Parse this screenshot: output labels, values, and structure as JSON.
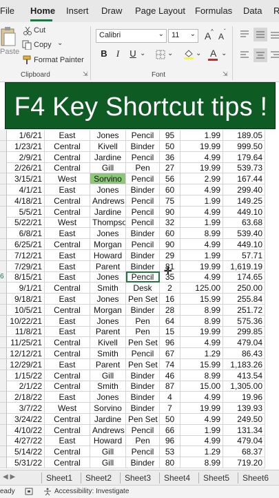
{
  "ribbon": {
    "tabs": [
      "File",
      "Home",
      "Insert",
      "Draw",
      "Page Layout",
      "Formulas",
      "Data",
      "R"
    ],
    "active_tab": "Home",
    "clipboard": {
      "paste": "Paste",
      "cut": "Cut",
      "copy": "Copy",
      "format_painter": "Format Painter",
      "label": "Clipboard"
    },
    "font": {
      "name": "Calibri",
      "size": "11",
      "grow": "A",
      "shrink": "A",
      "bold": "B",
      "italic": "I",
      "underline": "U",
      "color_letter": "A",
      "label": "Font"
    },
    "colors": {
      "fill": "#ffff00",
      "font": "#e02020",
      "accent": "#217346"
    }
  },
  "banner": {
    "text": "F4 Key Shortcut tips !",
    "background": "#0f5b24"
  },
  "rows": [
    [
      "1/6/21",
      "East",
      "Jones",
      "Pencil",
      "95",
      "1.99",
      "189.05"
    ],
    [
      "1/23/21",
      "Central",
      "Kivell",
      "Binder",
      "50",
      "19.99",
      "999.50"
    ],
    [
      "2/9/21",
      "Central",
      "Jardine",
      "Pencil",
      "36",
      "4.99",
      "179.64"
    ],
    [
      "2/26/21",
      "Central",
      "Gill",
      "Pen",
      "27",
      "19.99",
      "539.73"
    ],
    [
      "3/15/21",
      "West",
      "Sorvino",
      "Pencil",
      "56",
      "2.99",
      "167.44"
    ],
    [
      "4/1/21",
      "East",
      "Jones",
      "Binder",
      "60",
      "4.99",
      "299.40"
    ],
    [
      "4/18/21",
      "Central",
      "Andrews",
      "Pencil",
      "75",
      "1.99",
      "149.25"
    ],
    [
      "5/5/21",
      "Central",
      "Jardine",
      "Pencil",
      "90",
      "4.99",
      "449.10"
    ],
    [
      "5/22/21",
      "West",
      "Thompson",
      "Pencil",
      "32",
      "1.99",
      "63.68"
    ],
    [
      "6/8/21",
      "East",
      "Jones",
      "Binder",
      "60",
      "8.99",
      "539.40"
    ],
    [
      "6/25/21",
      "Central",
      "Morgan",
      "Pencil",
      "90",
      "4.99",
      "449.10"
    ],
    [
      "7/12/21",
      "East",
      "Howard",
      "Binder",
      "29",
      "1.99",
      "57.71"
    ],
    [
      "7/29/21",
      "East",
      "Parent",
      "Binder",
      "81",
      "19.99",
      "1,619.19"
    ],
    [
      "8/15/21",
      "East",
      "Jones",
      "Pencil",
      "35",
      "4.99",
      "174.65"
    ],
    [
      "9/1/21",
      "Central",
      "Smith",
      "Desk",
      "2",
      "125.00",
      "250.00"
    ],
    [
      "9/18/21",
      "East",
      "Jones",
      "Pen Set",
      "16",
      "15.99",
      "255.84"
    ],
    [
      "10/5/21",
      "Central",
      "Morgan",
      "Binder",
      "28",
      "8.99",
      "251.72"
    ],
    [
      "10/22/21",
      "East",
      "Jones",
      "Pen",
      "64",
      "8.99",
      "575.36"
    ],
    [
      "11/8/21",
      "East",
      "Parent",
      "Pen",
      "15",
      "19.99",
      "299.85"
    ],
    [
      "11/25/21",
      "Central",
      "Kivell",
      "Pen Set",
      "96",
      "4.99",
      "479.04"
    ],
    [
      "12/12/21",
      "Central",
      "Smith",
      "Pencil",
      "67",
      "1.29",
      "86.43"
    ],
    [
      "12/29/21",
      "East",
      "Parent",
      "Pen Set",
      "74",
      "15.99",
      "1,183.26"
    ],
    [
      "1/15/22",
      "Central",
      "Gill",
      "Binder",
      "46",
      "8.99",
      "413.54"
    ],
    [
      "2/1/22",
      "Central",
      "Smith",
      "Binder",
      "87",
      "15.00",
      "1,305.00"
    ],
    [
      "2/18/22",
      "East",
      "Jones",
      "Binder",
      "4",
      "4.99",
      "19.96"
    ],
    [
      "3/7/22",
      "West",
      "Sorvino",
      "Binder",
      "7",
      "19.99",
      "139.93"
    ],
    [
      "3/24/22",
      "Central",
      "Jardine",
      "Pen Set",
      "50",
      "4.99",
      "249.50"
    ],
    [
      "4/10/22",
      "Central",
      "Andrews",
      "Pencil",
      "66",
      "1.99",
      "131.34"
    ],
    [
      "4/27/22",
      "East",
      "Howard",
      "Pen",
      "96",
      "4.99",
      "479.04"
    ],
    [
      "5/14/22",
      "Central",
      "Gill",
      "Pencil",
      "53",
      "1.29",
      "68.37"
    ],
    [
      "5/31/22",
      "Central",
      "Gill",
      "Binder",
      "80",
      "8.99",
      "719.20"
    ]
  ],
  "row_headers": {
    "13": "6"
  },
  "highlighted_cell": {
    "row": 4,
    "col": 2,
    "color": "#8cc977"
  },
  "selected_cell": {
    "row": 13,
    "col": 3
  },
  "sheets": [
    "Sheet1",
    "Sheet2",
    "Sheet3",
    "Sheet4",
    "Sheet5",
    "Sheet6"
  ],
  "status": {
    "left": "eady",
    "accessibility": "Accessibility: Investigate"
  }
}
